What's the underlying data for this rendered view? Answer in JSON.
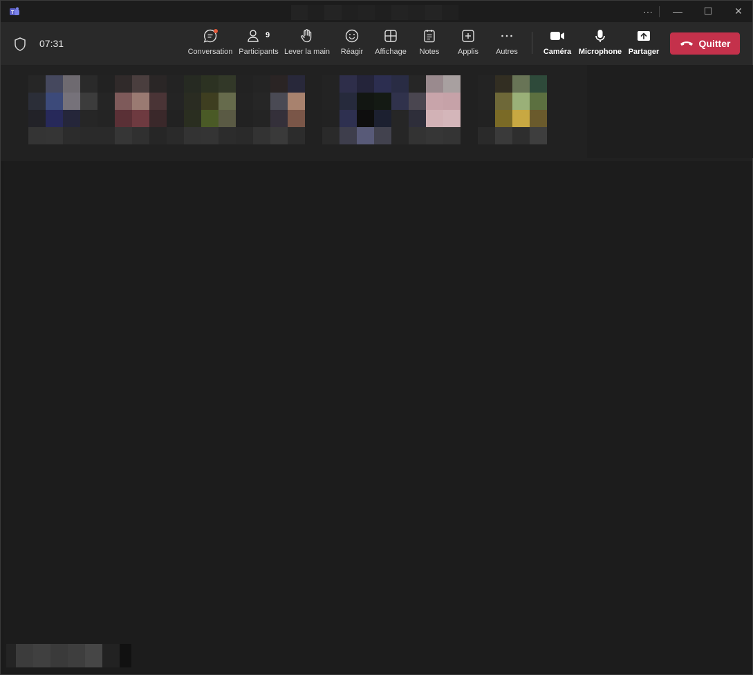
{
  "window": {
    "more_label": "···",
    "minimize_label": "—",
    "maximize_label": "☐",
    "close_label": "✕"
  },
  "meeting": {
    "elapsed_time": "07:31"
  },
  "toolbar": {
    "chat": {
      "label": "Conversation",
      "icon": "chat-icon",
      "has_notification": true
    },
    "participants": {
      "label": "Participants",
      "icon": "people-icon",
      "count": "9"
    },
    "raise_hand": {
      "label": "Lever la main",
      "icon": "hand-icon"
    },
    "react": {
      "label": "Réagir",
      "icon": "emoji-icon"
    },
    "view": {
      "label": "Affichage",
      "icon": "grid-icon"
    },
    "notes": {
      "label": "Notes",
      "icon": "notes-icon"
    },
    "apps": {
      "label": "Applis",
      "icon": "plus-icon"
    },
    "more": {
      "label": "Autres",
      "icon": "more-icon"
    },
    "camera": {
      "label": "Caméra",
      "icon": "camera-icon"
    },
    "microphone": {
      "label": "Microphone",
      "icon": "microphone-icon"
    },
    "share": {
      "label": "Partager",
      "icon": "share-icon"
    },
    "leave": {
      "label": "Quitter",
      "icon": "phone-hangup-icon",
      "color": "#c4314b"
    }
  },
  "colors": {
    "background": "#1b1b1b",
    "toolbar": "#292929",
    "strip": "#212121",
    "accent_red": "#c4314b"
  }
}
